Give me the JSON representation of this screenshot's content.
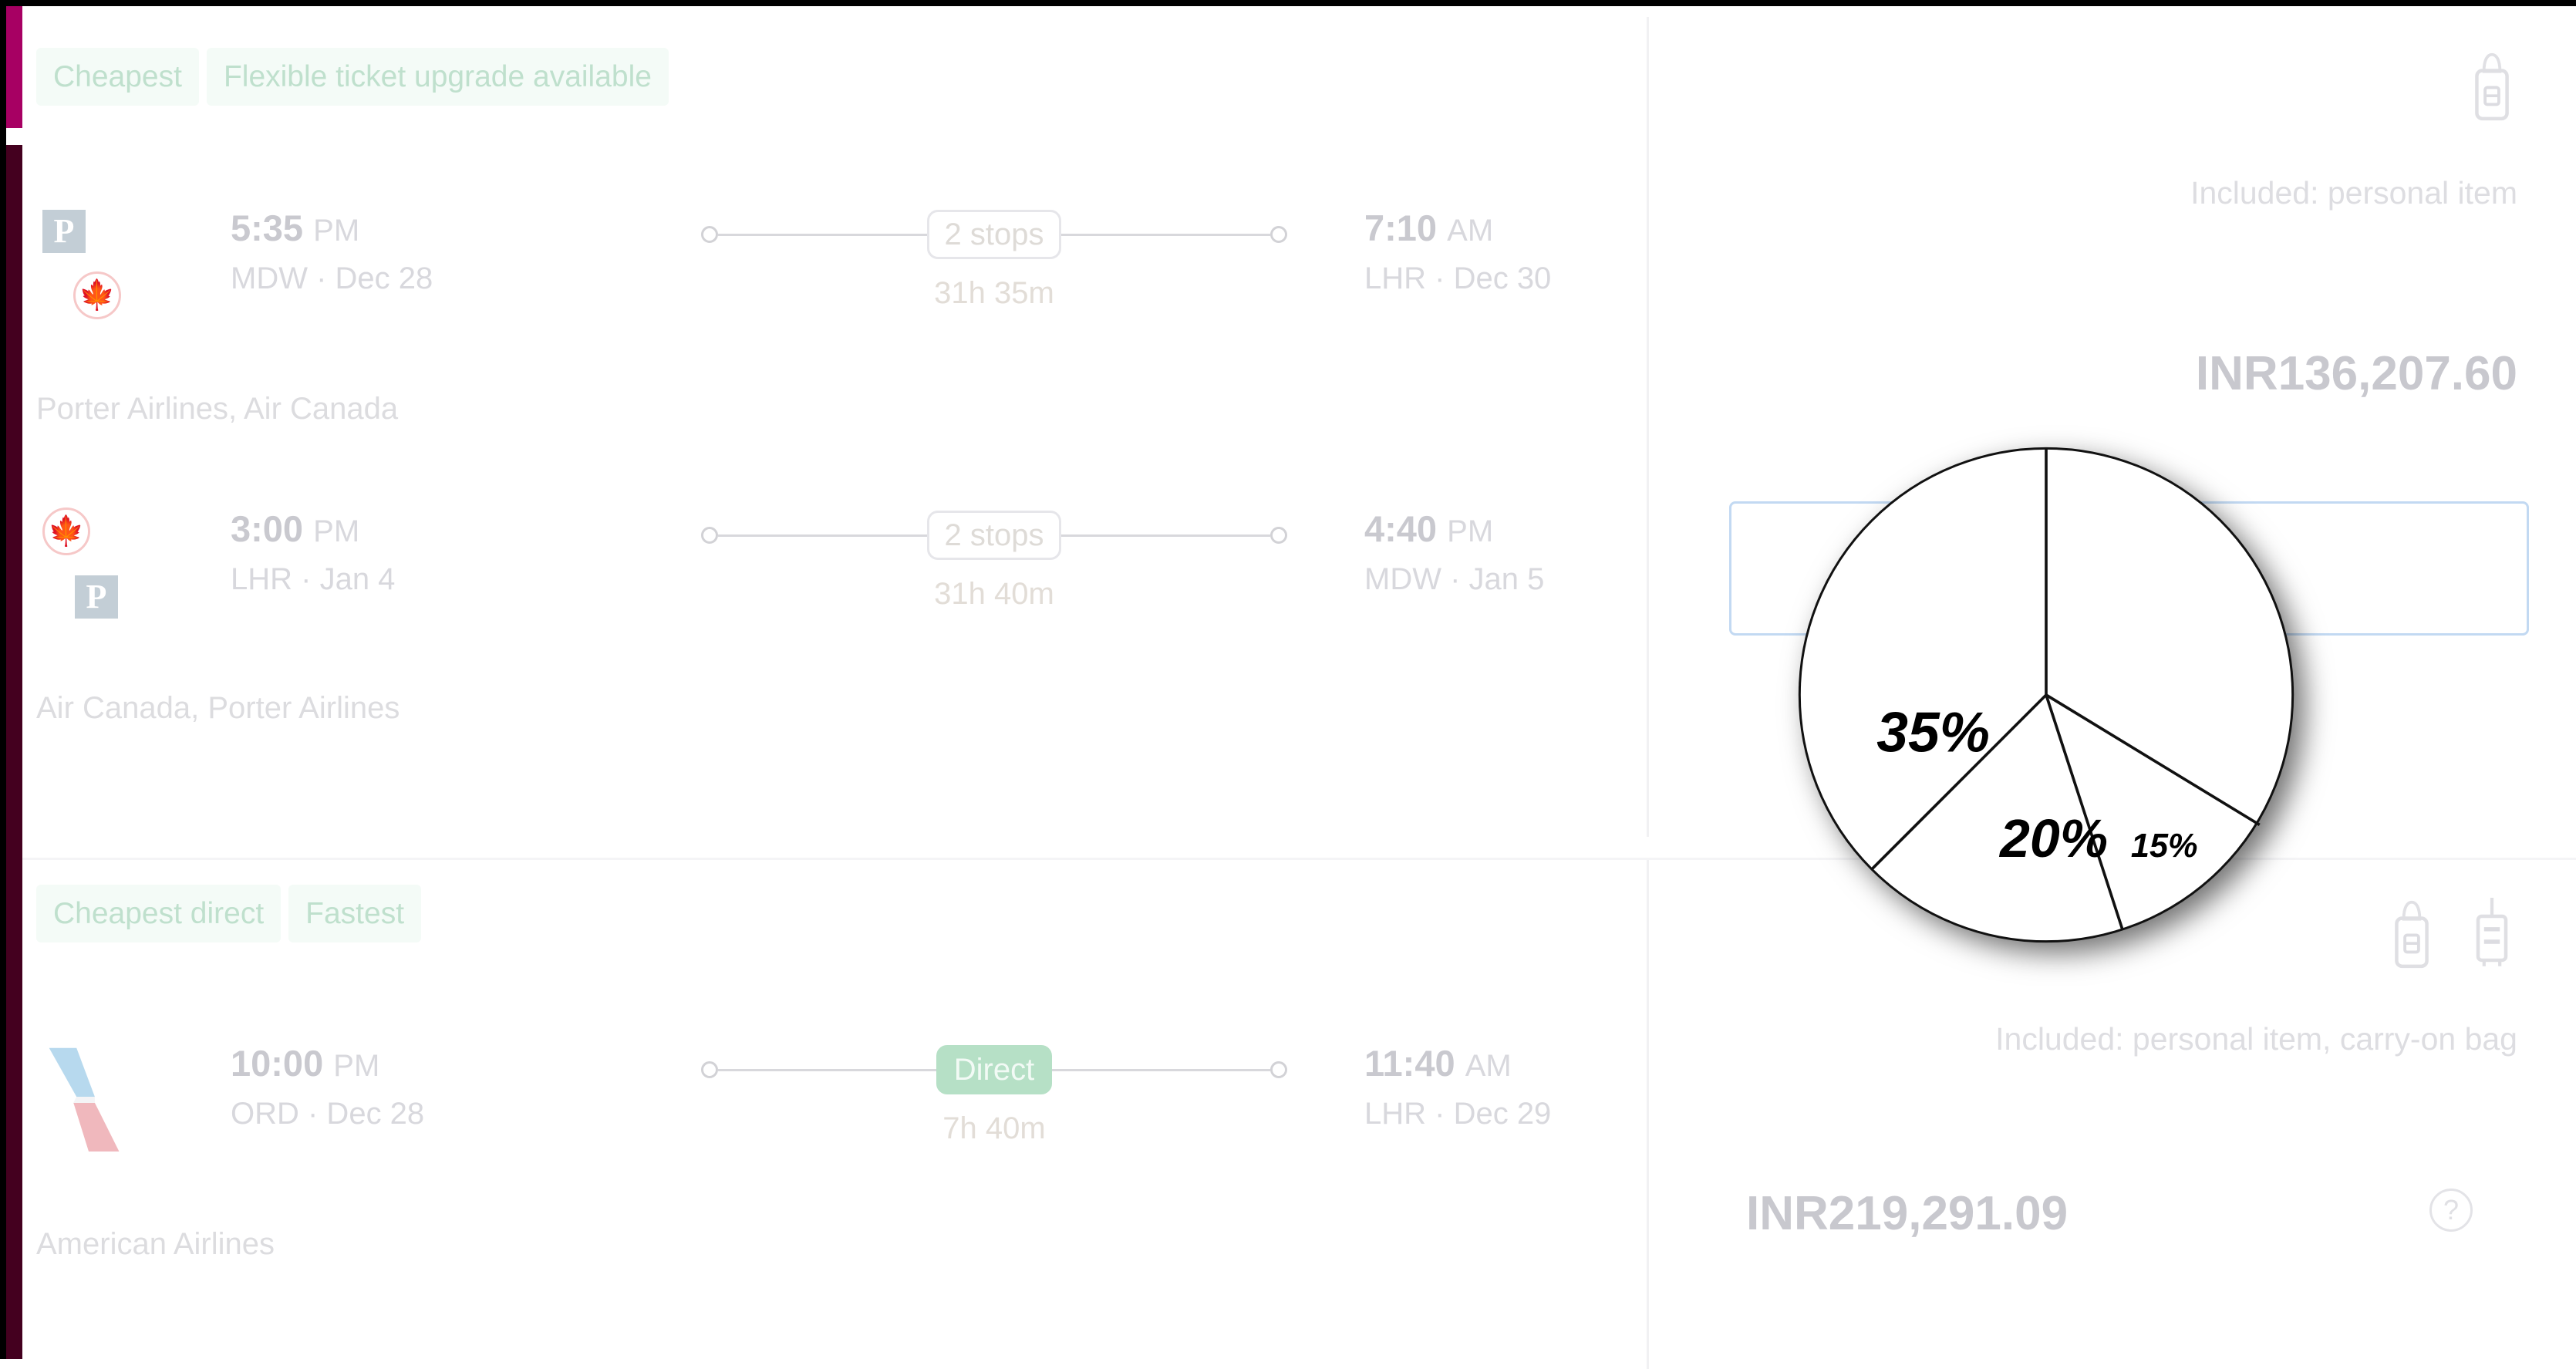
{
  "theme": {
    "rail_magenta": "#a70063",
    "rail_dark": "#44001f",
    "badge_bg": "#f4fbf7",
    "badge_text": "#bfe0cd",
    "direct_pill_bg": "#b6e0c6",
    "select_border": "#c2d9f2",
    "price_text": "#c8c8ce"
  },
  "flights": [
    {
      "badges": [
        "Cheapest",
        "Flexible ticket upgrade available"
      ],
      "legs": [
        {
          "carriers": [
            "porter-logo",
            "air-canada-logo"
          ],
          "depart_time": "5:35",
          "depart_ampm": "PM",
          "depart_place": "MDW · Dec 28",
          "stops": "2 stops",
          "duration": "31h 35m",
          "arrive_time": "7:10",
          "arrive_ampm": "AM",
          "arrive_place": "LHR · Dec 30",
          "operator": "Porter Airlines, Air Canada"
        },
        {
          "carriers": [
            "air-canada-logo",
            "porter-logo"
          ],
          "depart_time": "3:00",
          "depart_ampm": "PM",
          "depart_place": "LHR · Jan 4",
          "stops": "2 stops",
          "duration": "31h 40m",
          "arrive_time": "4:40",
          "arrive_ampm": "PM",
          "arrive_place": "MDW · Jan 5",
          "operator": "Air Canada, Porter Airlines"
        }
      ],
      "baggage_icons": [
        "personal-item-icon"
      ],
      "included_text": "Included: personal item",
      "price": "INR136,207.60",
      "has_help_icon": false,
      "select_button_label": ""
    },
    {
      "badges": [
        "Cheapest direct",
        "Fastest"
      ],
      "legs": [
        {
          "carriers": [
            "american-airlines-logo"
          ],
          "depart_time": "10:00",
          "depart_ampm": "PM",
          "depart_place": "ORD · Dec 28",
          "stops": "Direct",
          "duration": "7h 40m",
          "arrive_time": "11:40",
          "arrive_ampm": "AM",
          "arrive_place": "LHR · Dec 29",
          "operator": "American Airlines"
        }
      ],
      "baggage_icons": [
        "personal-item-icon",
        "carry-on-bag-icon"
      ],
      "included_text": "Included: personal item, carry-on bag",
      "price": "INR219,291.09",
      "has_help_icon": true,
      "select_button_label": ""
    }
  ],
  "chart_data": {
    "type": "pie",
    "title": "",
    "labels": [
      "35%",
      "20%",
      "15%",
      ""
    ],
    "values": [
      35,
      20,
      15,
      30
    ],
    "value_labels": [
      "35%",
      "20%",
      "15%",
      null
    ],
    "start_angle_deg": 0,
    "direction": "counterclockwise",
    "slice_fill": "#ffffff",
    "slice_stroke": "#000000",
    "legend": "none",
    "label_texts": {
      "slice_35": "35%",
      "slice_20": "20%",
      "slice_15": "15%"
    }
  }
}
